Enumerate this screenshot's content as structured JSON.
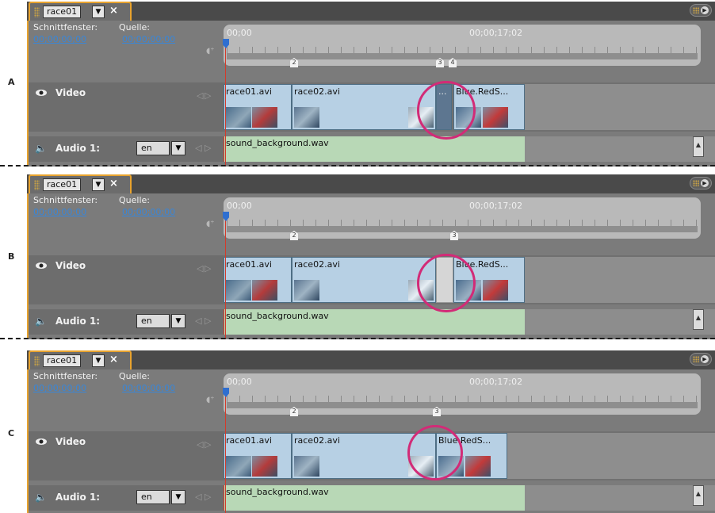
{
  "panels": [
    {
      "letter": "A",
      "tab_name": "race01",
      "labels": {
        "sequence": "Schnittfenster:",
        "source": "Quelle:"
      },
      "timecodes": {
        "sequence": "00;00;00;00",
        "source": "00;00;00;00"
      },
      "ruler": {
        "start": "00;00",
        "end": "00;00;17;02"
      },
      "markers": [
        "2",
        "3",
        "4"
      ],
      "video_track": "Video",
      "clips": [
        "race01.avi",
        "race02.avi",
        "...",
        "Blue.RedS..."
      ],
      "audio_track": "Audio 1:",
      "language": "en",
      "audio_clip": "sound_background.wav"
    },
    {
      "letter": "B",
      "tab_name": "race01",
      "labels": {
        "sequence": "Schnittfenster:",
        "source": "Quelle:"
      },
      "timecodes": {
        "sequence": "00;00;00;00",
        "source": "00;00;00;00"
      },
      "ruler": {
        "start": "00;00",
        "end": "00;00;17;02"
      },
      "markers": [
        "2",
        "3"
      ],
      "video_track": "Video",
      "clips": [
        "race01.avi",
        "race02.avi",
        "Blue.RedS..."
      ],
      "audio_track": "Audio 1:",
      "language": "en",
      "audio_clip": "sound_background.wav"
    },
    {
      "letter": "C",
      "tab_name": "race01",
      "labels": {
        "sequence": "Schnittfenster:",
        "source": "Quelle:"
      },
      "timecodes": {
        "sequence": "00;00;00;00",
        "source": "00;00;00;00"
      },
      "ruler": {
        "start": "00;00",
        "end": "00;00;17;02"
      },
      "markers": [
        "2",
        "3"
      ],
      "video_track": "Video",
      "clips": [
        "race01.avi",
        "race02.avi",
        "Blue.RedS..."
      ],
      "audio_track": "Audio 1:",
      "language": "en",
      "audio_clip": "sound_background.wav"
    }
  ],
  "colors": {
    "accent": "#e8a32e",
    "timecode": "#3a86d6",
    "video_clip": "#b7d0e4",
    "audio_clip": "#b8d8b6",
    "highlight_circle": "#d22b77",
    "playhead": "#d33a2a"
  },
  "icons": [
    "eye-icon",
    "speaker-icon",
    "snap-icon",
    "panel-menu-icon",
    "close-icon",
    "dropdown-icon"
  ]
}
